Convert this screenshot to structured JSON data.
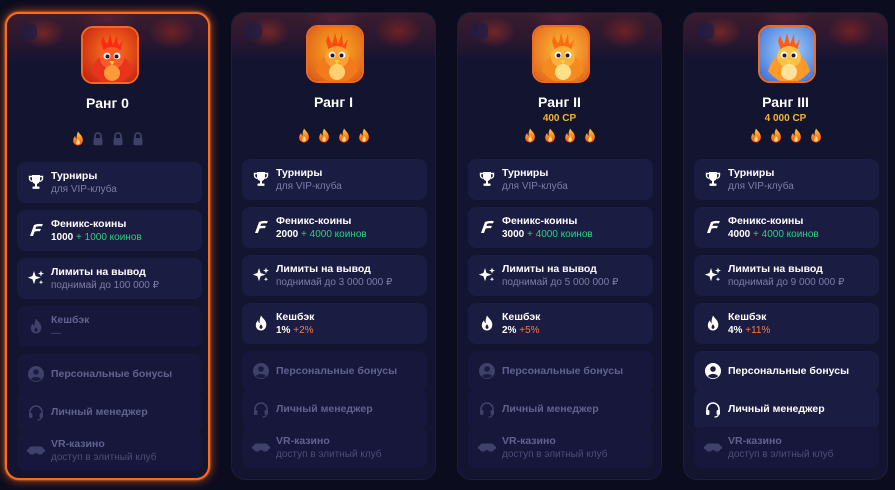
{
  "colors": {
    "accent": "#ff6a1a",
    "points": "#f7b22c",
    "plus_green": "#2fd07a",
    "plus_orange": "#ff7a45"
  },
  "ranks": [
    {
      "title": "Ранг 0",
      "points": "",
      "avatar": "phoenix-chick",
      "flames": [
        "flame",
        "lock",
        "lock",
        "lock"
      ],
      "features": [
        {
          "title": "Турниры",
          "sub": "для VIP-клуба"
        },
        {
          "title": "Феникс-коины",
          "value": "1000",
          "plus": "+ 1000 коинов"
        },
        {
          "title": "Лимиты на вывод",
          "sub": "поднимай до 100 000 ₽"
        },
        {
          "title": "Кешбэк",
          "sub": "—"
        },
        {
          "title": "Персональные бонусы"
        },
        {
          "title": "Личный менеджер"
        },
        {
          "title": "VR-казино",
          "sub": "доступ в элитный клуб"
        }
      ]
    },
    {
      "title": "Ранг I",
      "points": "",
      "avatar": "phoenix-young",
      "flames": [
        "flame",
        "flame",
        "flame",
        "flame"
      ],
      "features": [
        {
          "title": "Турниры",
          "sub": "для VIP-клуба"
        },
        {
          "title": "Феникс-коины",
          "value": "2000",
          "plus": "+ 4000 коинов"
        },
        {
          "title": "Лимиты на вывод",
          "sub": "поднимай до 3 000 000 ₽"
        },
        {
          "title": "Кешбэк",
          "value": "1%",
          "plus": "+2%"
        },
        {
          "title": "Персональные бонусы"
        },
        {
          "title": "Личный менеджер"
        },
        {
          "title": "VR-казино",
          "sub": "доступ в элитный клуб"
        }
      ]
    },
    {
      "title": "Ранг II",
      "points": "400 CP",
      "avatar": "phoenix-adult",
      "flames": [
        "flame",
        "flame",
        "flame",
        "flame"
      ],
      "features": [
        {
          "title": "Турниры",
          "sub": "для VIP-клуба"
        },
        {
          "title": "Феникс-коины",
          "value": "3000",
          "plus": "+ 4000 коинов"
        },
        {
          "title": "Лимиты на вывод",
          "sub": "поднимай до 5 000 000 ₽"
        },
        {
          "title": "Кешбэк",
          "value": "2%",
          "plus": "+5%"
        },
        {
          "title": "Персональные бонусы"
        },
        {
          "title": "Личный менеджер"
        },
        {
          "title": "VR-казино",
          "sub": "доступ в элитный клуб"
        }
      ]
    },
    {
      "title": "Ранг III",
      "points": "4 000 CP",
      "avatar": "phoenix-elder",
      "flames": [
        "flame",
        "flame",
        "flame",
        "flame"
      ],
      "features": [
        {
          "title": "Турниры",
          "sub": "для VIP-клуба"
        },
        {
          "title": "Феникс-коины",
          "value": "4000",
          "plus": "+ 4000 коинов"
        },
        {
          "title": "Лимиты на вывод",
          "sub": "поднимай до 9 000 000 ₽"
        },
        {
          "title": "Кешбэк",
          "value": "4%",
          "plus": "+11%"
        },
        {
          "title": "Персональные бонусы"
        },
        {
          "title": "Личный менеджер"
        },
        {
          "title": "VR-казино",
          "sub": "доступ в элитный клуб"
        }
      ]
    }
  ],
  "feature_icons": [
    "trophy-icon",
    "phoenix-coin-icon",
    "sparkles-icon",
    "cashback-flame-icon",
    "user-icon",
    "headset-icon",
    "vr-headset-icon"
  ],
  "feature_states": [
    [
      "on",
      "on",
      "on",
      "off",
      "off",
      "off",
      "off"
    ],
    [
      "on",
      "on",
      "on",
      "on",
      "off",
      "off",
      "off"
    ],
    [
      "on",
      "on",
      "on",
      "on",
      "off",
      "off",
      "off"
    ],
    [
      "on",
      "on",
      "on",
      "on",
      "on",
      "on",
      "off"
    ]
  ]
}
